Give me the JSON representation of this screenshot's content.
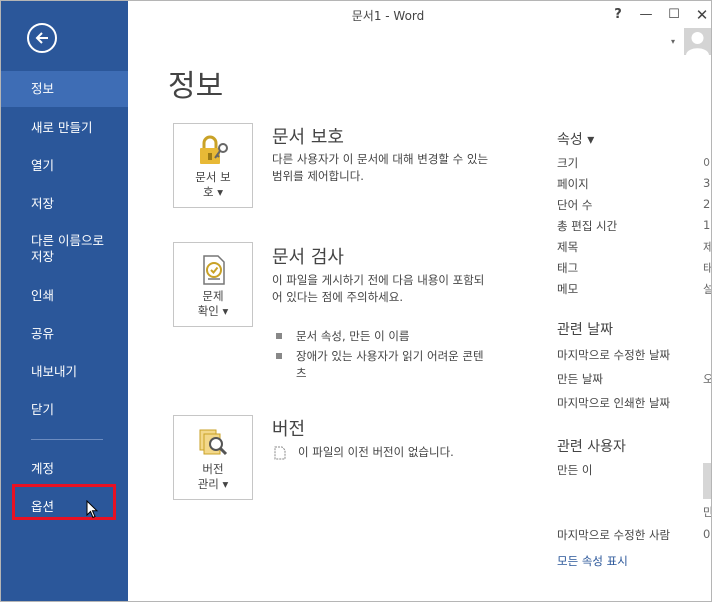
{
  "window": {
    "title": "문서1 - Word",
    "help": "?",
    "restore": "❐",
    "minimize": "—",
    "maximize": "☐",
    "user_dropdown": "▾"
  },
  "nav": {
    "back_icon": "arrow-left-icon",
    "items": [
      {
        "label": "정보",
        "selected": true
      },
      {
        "label": "새로 만들기"
      },
      {
        "label": "열기"
      },
      {
        "label": "저장"
      },
      {
        "label": "다른 이름으로 저장"
      },
      {
        "label": "인쇄"
      },
      {
        "label": "공유"
      },
      {
        "label": "내보내기"
      },
      {
        "label": "닫기"
      },
      {
        "label": "계정"
      },
      {
        "label": "옵션",
        "highlighted": true
      }
    ]
  },
  "main": {
    "title": "정보",
    "protect": {
      "tile_line1": "문서 보",
      "tile_line2": "호 ▾",
      "heading": "문서 보호",
      "desc": "다른 사용자가 이 문서에 대해 변경할 수 있는 범위를 제어합니다."
    },
    "inspect": {
      "tile_line1": "문제",
      "tile_line2": "확인 ▾",
      "heading": "문서 검사",
      "desc": "이 파일을 게시하기 전에 다음 내용이 포함되어 있다는 점에 주의하세요.",
      "bullets": [
        "문서 속성, 만든 이 이름",
        "장애가 있는 사용자가 읽기 어려운 콘텐츠"
      ]
    },
    "versions": {
      "tile_line1": "버전",
      "tile_line2": "관리 ▾",
      "heading": "버전",
      "desc": "이 파일의 이전 버전이 없습니다."
    }
  },
  "properties": {
    "heading": "속성 ▾",
    "rows": [
      {
        "label": "크기",
        "value": "이"
      },
      {
        "label": "페이지",
        "value": "3"
      },
      {
        "label": "단어 수",
        "value": "2"
      },
      {
        "label": "총 편집 시간",
        "value": "1"
      },
      {
        "label": "제목",
        "value": "제"
      },
      {
        "label": "태그",
        "value": "태"
      },
      {
        "label": "메모",
        "value": "설"
      }
    ],
    "dates_heading": "관련 날짜",
    "dates": [
      {
        "label": "마지막으로 수정한 날짜",
        "value": ""
      },
      {
        "label": "만든 날짜",
        "value": "오"
      },
      {
        "label": "마지막으로 인쇄한 날짜",
        "value": ""
      }
    ],
    "people_heading": "관련 사용자",
    "author_label": "만든 이",
    "author_value": "만",
    "last_modified_by_label": "마지막으로 수정한 사람",
    "last_modified_by_value": "0",
    "show_all": "모든 속성 표시"
  }
}
